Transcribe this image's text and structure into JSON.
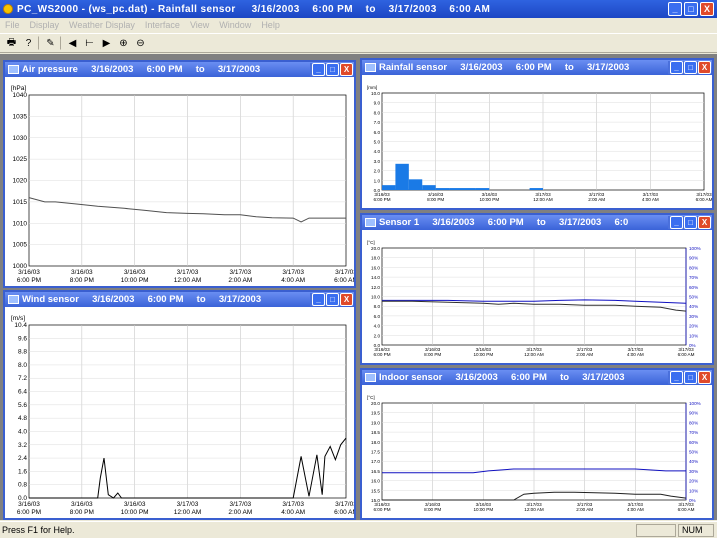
{
  "app": {
    "title": "PC_WS2000 - (ws_pc.dat) - Rainfall sensor     3/16/2003    6:00 PM    to    3/17/2003    6:00 AM",
    "win_min": "_",
    "win_max": "□",
    "win_close": "X"
  },
  "menu": [
    "File",
    "Display",
    "Weather Display",
    "Interface",
    "View",
    "Window",
    "Help"
  ],
  "toolbar": [
    {
      "name": "print-icon",
      "glyph": "🖶"
    },
    {
      "name": "help-pointer-icon",
      "glyph": "?"
    },
    {
      "name": "sep"
    },
    {
      "name": "edit-icon",
      "glyph": "✎"
    },
    {
      "name": "sep"
    },
    {
      "name": "arrow-left-icon",
      "glyph": "◀"
    },
    {
      "name": "range-icon",
      "glyph": "⊢"
    },
    {
      "name": "arrow-right-icon",
      "glyph": "▶"
    },
    {
      "name": "zoom-in-icon",
      "glyph": "⊕"
    },
    {
      "name": "zoom-out-icon",
      "glyph": "⊖"
    }
  ],
  "status": {
    "text": "Press F1 for Help.",
    "num": "NUM"
  },
  "xticks": [
    [
      "3/16/03",
      "6:00 PM"
    ],
    [
      "3/16/03",
      "8:00 PM"
    ],
    [
      "3/16/03",
      "10:00 PM"
    ],
    [
      "3/17/03",
      "12:00 AM"
    ],
    [
      "3/17/03",
      "2:00 AM"
    ],
    [
      "3/17/03",
      "4:00 AM"
    ],
    [
      "3/17/03",
      "6:00 AM"
    ]
  ],
  "chart_data": [
    {
      "window": "air-pressure",
      "type": "line",
      "title": "Air pressure     3/16/2003     6:00 PM     to     3/17/2003",
      "ylabel": "[hPa]",
      "ylim": [
        1000,
        1040
      ],
      "yticks": [
        1000,
        1005,
        1010,
        1015,
        1020,
        1025,
        1030,
        1035,
        1040
      ],
      "series": [
        {
          "color": "#505050",
          "x": [
            0,
            0.3,
            0.5,
            0.9,
            1.3,
            1.8,
            2.2,
            2.6,
            3.0,
            3.3,
            3.7,
            4.0,
            4.3,
            4.6,
            5.0,
            5.15,
            5.3,
            5.6,
            6.0
          ],
          "values": [
            1016,
            1015,
            1015,
            1014.5,
            1014,
            1013.5,
            1013,
            1012.5,
            1012.3,
            1012.2,
            1012,
            1012,
            1011.5,
            1011.3,
            1011.2,
            1010.3,
            1011.2,
            1011.2,
            1011.2
          ]
        }
      ]
    },
    {
      "window": "wind-sensor",
      "type": "line",
      "title": "Wind sensor     3/16/2003     6:00 PM     to     3/17/2003",
      "ylabel": "[m/s]",
      "ylim": [
        0,
        10.4
      ],
      "yticks": [
        0,
        0.8,
        1.6,
        2.4,
        3.2,
        4.0,
        4.8,
        5.6,
        6.4,
        7.2,
        8.0,
        8.8,
        9.6,
        10.4
      ],
      "ytick_labels": [
        "0.0",
        "0.8",
        "1.6",
        "2.4",
        "3.2",
        "4.0",
        "4.8",
        "5.6",
        "6.4",
        "7.2",
        "8.0",
        "8.8",
        "9.6",
        "10.4"
      ],
      "series": [
        {
          "color": "#000000",
          "x": [
            0,
            1.3,
            1.35,
            1.42,
            1.5,
            1.6,
            1.68,
            1.75,
            5.0,
            5.15,
            5.3,
            5.45,
            5.55,
            5.6,
            5.7,
            5.8,
            5.9,
            6.0
          ],
          "values": [
            0,
            0,
            1.2,
            2.4,
            0.2,
            0,
            0.3,
            0,
            0,
            2.5,
            0.1,
            2.6,
            0.2,
            2.5,
            3.1,
            2.3,
            3.2,
            3.6
          ]
        }
      ]
    },
    {
      "window": "rainfall-sensor",
      "type": "bar",
      "title": "Rainfall sensor     3/16/2003     6:00 PM     to     3/17/2003",
      "ylabel": "[mm]",
      "ylim": [
        0,
        10
      ],
      "yticks": [
        0,
        1,
        2,
        3,
        4,
        5,
        6,
        7,
        8,
        9,
        10
      ],
      "ytick_labels": [
        "0.0",
        "1.0",
        "2.0",
        "3.0",
        "4.0",
        "5.0",
        "6.0",
        "7.0",
        "8.0",
        "9.0",
        "10.0"
      ],
      "bar_width": 0.25,
      "x": [
        0,
        0.25,
        0.5,
        0.75,
        1.0,
        1.25,
        1.5,
        1.75,
        2.0,
        2.25,
        2.5,
        2.75,
        3.0,
        3.25,
        3.5,
        3.75,
        4.0,
        4.25,
        4.5,
        4.75,
        5.0,
        5.25,
        5.5,
        5.75
      ],
      "values": [
        0.5,
        2.7,
        1.1,
        0.5,
        0.2,
        0.2,
        0.2,
        0.2,
        0,
        0,
        0,
        0.2,
        0,
        0,
        0,
        0,
        0,
        0,
        0,
        0,
        0,
        0,
        0,
        0
      ],
      "color": "#1a7ae6"
    },
    {
      "window": "sensor-1",
      "type": "line",
      "title": "Sensor 1     3/16/2003     6:00 PM     to     3/17/2003     6:0",
      "ylabel": "[°C]",
      "ylim": [
        0,
        20
      ],
      "yticks": [
        0,
        2,
        4,
        6,
        8,
        10,
        12,
        14,
        16,
        18,
        20
      ],
      "ytick_labels": [
        "0.0",
        "2.0",
        "4.0",
        "6.0",
        "8.0",
        "10.0",
        "12.0",
        "14.0",
        "16.0",
        "18.0",
        "20.0"
      ],
      "y2ticks": [
        "0%",
        "10%",
        "20%",
        "30%",
        "40%",
        "50%",
        "60%",
        "70%",
        "80%",
        "90%",
        "100%"
      ],
      "series": [
        {
          "color": "#1010c0",
          "x": [
            0,
            0.6,
            1.3,
            2.0,
            3.0,
            3.5,
            4.0,
            4.6,
            5.0,
            5.5,
            6.0
          ],
          "values": [
            9.2,
            9.2,
            9.2,
            9.0,
            9.0,
            9.2,
            9.3,
            9.2,
            9.0,
            8.8,
            8.6
          ]
        },
        {
          "color": "#303030",
          "x": [
            0,
            0.6,
            1.3,
            2.0,
            2.3,
            2.6,
            3.0,
            3.5,
            4.0,
            4.6,
            5.0,
            5.5,
            5.8,
            6.0
          ],
          "values": [
            9.0,
            9.0,
            8.8,
            8.6,
            8.4,
            8.6,
            8.4,
            8.4,
            8.2,
            8.2,
            8.0,
            7.8,
            7.2,
            7.0
          ]
        }
      ]
    },
    {
      "window": "indoor-sensor",
      "type": "line",
      "title": "Indoor sensor     3/16/2003     6:00 PM     to     3/17/2003",
      "ylabel": "[°C]",
      "ylim": [
        15,
        20
      ],
      "yticks": [
        15,
        15.5,
        16,
        16.5,
        17,
        17.5,
        18,
        18.5,
        19,
        19.5,
        20
      ],
      "ytick_labels": [
        "15.0",
        "15.5",
        "16.0",
        "16.5",
        "17.0",
        "17.5",
        "18.0",
        "18.5",
        "19.0",
        "19.5",
        "20.0"
      ],
      "y2ticks": [
        "0%",
        "10%",
        "20%",
        "30%",
        "40%",
        "50%",
        "60%",
        "70%",
        "80%",
        "90%",
        "100%"
      ],
      "series": [
        {
          "color": "#1010c0",
          "x": [
            0,
            1.0,
            1.8,
            2.1,
            2.6,
            3.0,
            3.8,
            4.4,
            5.0,
            5.6,
            6.0
          ],
          "values": [
            16.4,
            16.4,
            16.4,
            16.5,
            16.6,
            16.6,
            16.6,
            16.6,
            16.6,
            16.5,
            16.5
          ]
        },
        {
          "color": "#202020",
          "x": [
            0,
            2.6,
            2.8,
            3.0,
            3.4,
            3.8,
            4.6,
            5.0,
            5.5,
            5.7,
            6.0
          ],
          "values": [
            15.0,
            15.0,
            15.3,
            15.35,
            15.4,
            15.4,
            15.35,
            15.3,
            15.3,
            15.2,
            15.1
          ]
        }
      ]
    }
  ]
}
